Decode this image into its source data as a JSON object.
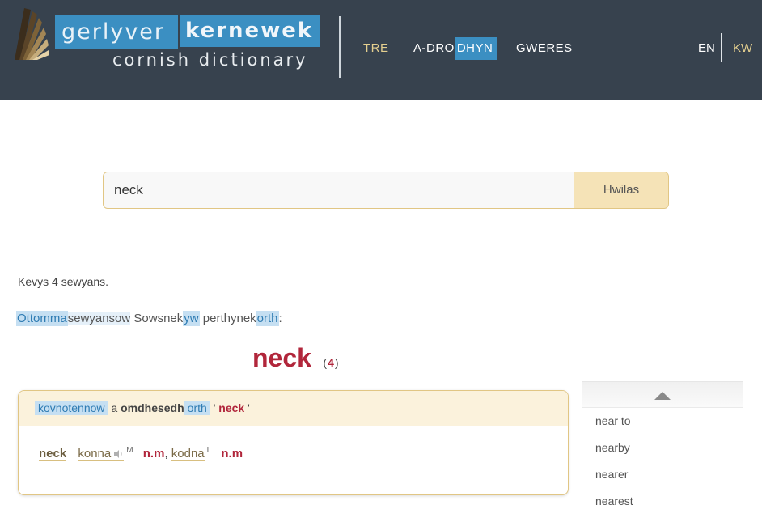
{
  "header": {
    "logo_word1": "gerlyver",
    "logo_word2": "kernewek",
    "logo_sub": "cornish dictionary",
    "nav": {
      "tre": "TRE",
      "adro_a": "A-DRO",
      "adro_b": "DHYN",
      "gweres": "GWERES"
    },
    "lang_en": "EN",
    "lang_kw": "KW"
  },
  "search": {
    "value": "neck",
    "button": "Hwilas"
  },
  "results": {
    "count_text": "Kevys 4 sewyans.",
    "other_line": {
      "w1": "Ottomma",
      "w2": "sewyansow",
      "w3": "Sowsnek",
      "w4": "yw",
      "w5": "perthynek",
      "w6": "orth",
      "w7": ":"
    },
    "headword": "neck",
    "headword_count_open": "(",
    "headword_count": "4",
    "headword_count_close": ")"
  },
  "entry": {
    "head": {
      "w1": "kovnotennow",
      "w2": "a",
      "w3": "omdhesedh",
      "w4": "orth",
      "q_open": "'",
      "term": "neck",
      "q_close": "'"
    },
    "body": {
      "term": "neck",
      "t1": "konna",
      "t1_sup": "M",
      "t1_pos": "n.m",
      "comma": ",",
      "t2": "kodna",
      "t2_sup": "L",
      "t2_pos": "n.m"
    }
  },
  "side_list": {
    "items": [
      "near to",
      "nearby",
      "nearer",
      "nearest"
    ]
  },
  "colors": {
    "header_bg": "#37424e",
    "accent_blue": "#3b8fc2",
    "accent_gold": "#e4cf8f",
    "headword_red": "#b1263b"
  }
}
